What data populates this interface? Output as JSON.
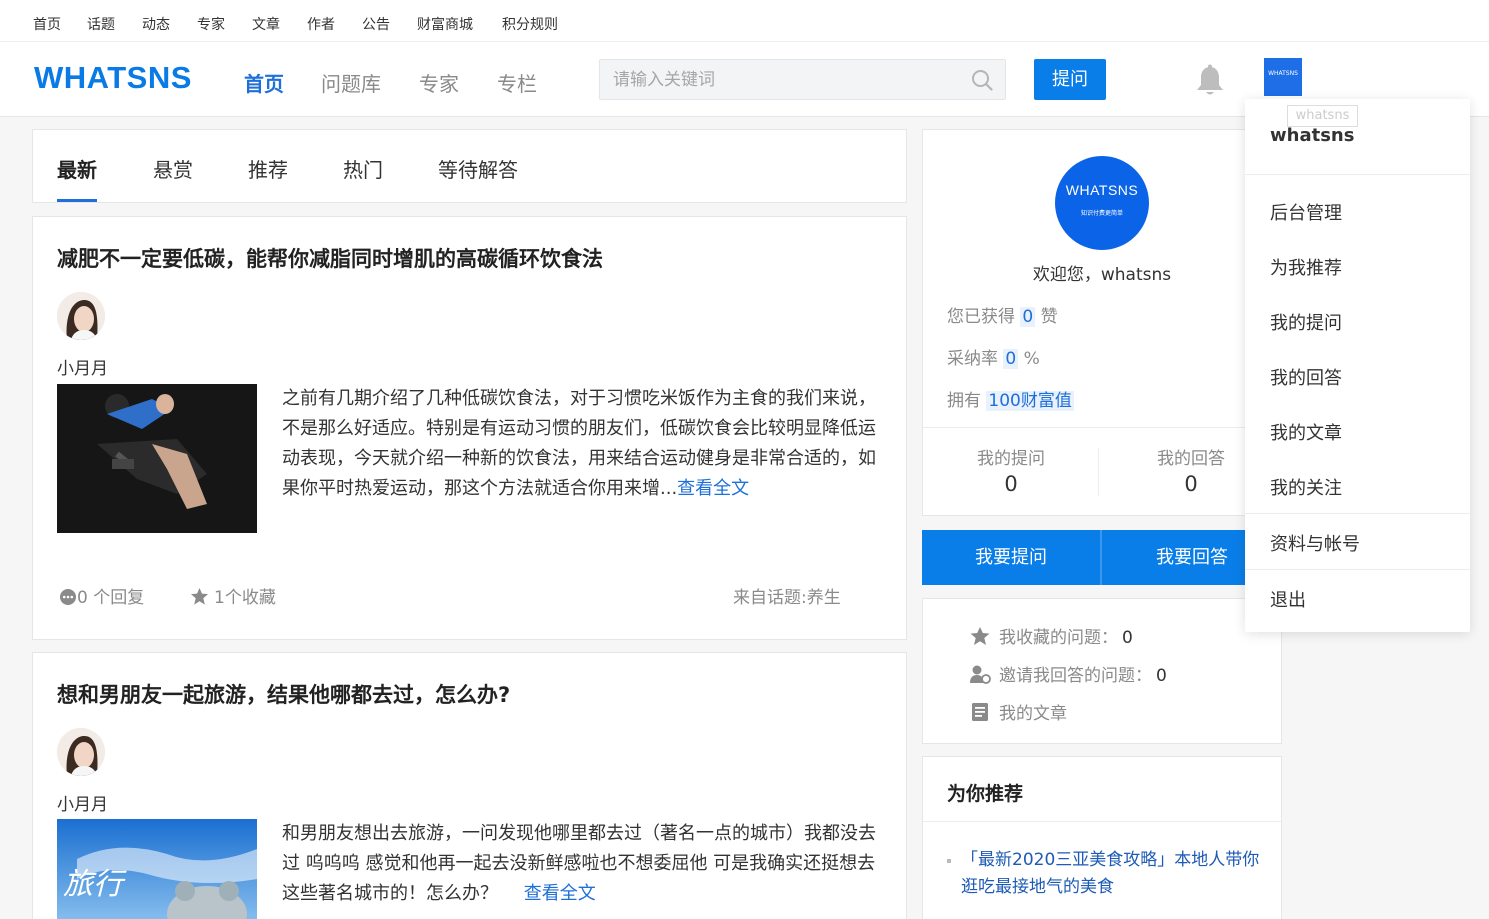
{
  "topbar": {
    "links": [
      "首页",
      "话题",
      "动态",
      "专家",
      "文章",
      "作者",
      "公告",
      "财富商城",
      "积分规则"
    ]
  },
  "header": {
    "logo": "WHATSNS",
    "nav": [
      "首页",
      "问题库",
      "专家",
      "专栏"
    ],
    "search_placeholder": "请输入关键词",
    "ask_label": "提问",
    "avatar_text": "WHATSNS"
  },
  "tabs": [
    "最新",
    "悬赏",
    "推荐",
    "热门",
    "等待解答"
  ],
  "feed": [
    {
      "title": "减肥不一定要低碳，能帮你减脂同时增肌的高碳循环饮食法",
      "author": "小月月",
      "excerpt": "之前有几期介绍了几种低碳饮食法，对于习惯吃米饭作为主食的我们来说，不是那么好适应。特别是有运动习惯的朋友们，低碳饮食会比较明显降低运动表现，今天就介绍一种新的饮食法，用来结合运动健身是非常合适的，如果你平时热爱运动，那这个方法就适合你用来增...",
      "more": "查看全文",
      "replies": "0 个回复",
      "favorites": "1个收藏",
      "topic": "来自话题:养生"
    },
    {
      "title": "想和男朋友一起旅游，结果他哪都去过，怎么办?",
      "author": "小月月",
      "excerpt": " 和男朋友想出去旅游，一问发现他哪里都去过（著名一点的城市）我都没去过 呜呜呜 感觉和他再一起去没新鲜感啦也不想委屈他 可是我确实还挺想去这些著名城市的！怎么办？ ",
      "more": "查看全文",
      "thumb_text": "旅行"
    }
  ],
  "profile": {
    "avatar_line1": "WHATSNS",
    "avatar_line2": "知识付费更简单",
    "welcome": "欢迎您，whatsns",
    "likes_prefix": "您已获得",
    "likes_value": "0",
    "likes_suffix": "赞",
    "adopt_prefix": "采纳率",
    "adopt_value": "0",
    "adopt_suffix": "%",
    "wealth_prefix": "拥有",
    "wealth_value": "100财富值",
    "my_questions_label": "我的提问",
    "my_questions_count": "0",
    "my_answers_label": "我的回答",
    "my_answers_count": "0"
  },
  "actions": {
    "ask": "我要提问",
    "answer": "我要回答"
  },
  "quick_links": {
    "fav": "我收藏的问题：",
    "fav_count": "0",
    "invite": "邀请我回答的问题：",
    "invite_count": "0",
    "articles": "我的文章"
  },
  "recommend": {
    "title": "为你推荐",
    "item": "「最新2020三亚美食攻略」本地人带你逛吃最接地气的美食"
  },
  "dropdown": {
    "tooltip": "whatsns",
    "username": "whatsns",
    "items": [
      "后台管理",
      "为我推荐",
      "我的提问",
      "我的回答",
      "我的文章",
      "我的关注"
    ],
    "account": "资料与帐号",
    "logout": "退出"
  },
  "colors": {
    "accent": "#0a7ee8",
    "link": "#1e6fd9"
  }
}
